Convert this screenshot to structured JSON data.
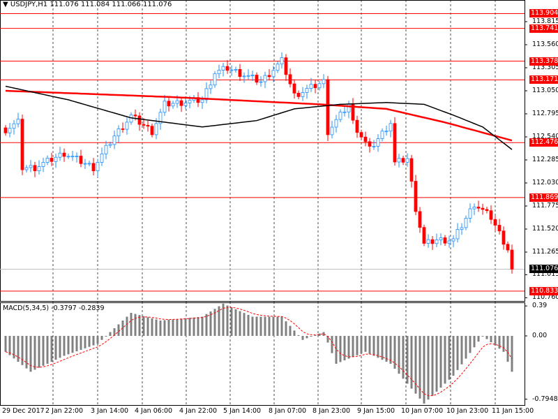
{
  "header": {
    "title": "USDJPY,H1",
    "ohlc": "111.076 111.084 111.066 111.076"
  },
  "macd": {
    "label": "MACD(5,34,5)",
    "values": "-0.3797 -0.2839",
    "axis": [
      "0.39",
      "0.00",
      "-0.7948"
    ]
  },
  "colors": {
    "up": "#1e90ff",
    "down": "#ff0000",
    "levels": "#ff0000",
    "ma_slow": "#ff0000",
    "ma_fast": "#000000",
    "hist": "#808080",
    "signal": "#ff0000"
  },
  "chart_data": {
    "type": "candlestick",
    "symbol": "USDJPY",
    "timeframe": "H1",
    "price_ticks": [
      "113.815",
      "113.560",
      "113.305",
      "113.050",
      "112.795",
      "112.540",
      "112.285",
      "112.030",
      "111.775",
      "111.520",
      "111.265",
      "111.015",
      "110.760"
    ],
    "levels": [
      "113.904",
      "113.741",
      "113.378",
      "113.171",
      "112.476",
      "111.869",
      "110.833"
    ],
    "current_price": "111.076",
    "time_labels": [
      "29 Dec 2017",
      "2 Jan 22:00",
      "3 Jan 14:00",
      "4 Jan 06:00",
      "4 Jan 22:00",
      "5 Jan 14:00",
      "8 Jan 07:00",
      "8 Jan 23:00",
      "9 Jan 15:00",
      "10 Jan 07:00",
      "10 Jan 23:00",
      "11 Jan 15:00"
    ],
    "candle_count": 122,
    "close_keypoints": [
      [
        0,
        112.62
      ],
      [
        3,
        112.7
      ],
      [
        4,
        112.2
      ],
      [
        7,
        112.2
      ],
      [
        14,
        112.36
      ],
      [
        21,
        112.2
      ],
      [
        26,
        112.55
      ],
      [
        30,
        112.77
      ],
      [
        35,
        112.6
      ],
      [
        38,
        112.9
      ],
      [
        47,
        112.95
      ],
      [
        50,
        113.25
      ],
      [
        53,
        113.3
      ],
      [
        61,
        113.15
      ],
      [
        66,
        113.38
      ],
      [
        69,
        113.0
      ],
      [
        76,
        113.15
      ],
      [
        77,
        112.6
      ],
      [
        82,
        112.9
      ],
      [
        83,
        112.7
      ],
      [
        87,
        112.4
      ],
      [
        92,
        112.7
      ],
      [
        93,
        112.25
      ],
      [
        96,
        112.3
      ],
      [
        98,
        111.75
      ],
      [
        100,
        111.35
      ],
      [
        103,
        111.4
      ],
      [
        107,
        111.4
      ],
      [
        112,
        111.8
      ],
      [
        116,
        111.65
      ],
      [
        120,
        111.3
      ],
      [
        121,
        111.076
      ]
    ],
    "ma_slow_keypoints": [
      [
        0,
        113.05
      ],
      [
        40,
        112.98
      ],
      [
        75,
        112.9
      ],
      [
        91,
        112.85
      ],
      [
        105,
        112.7
      ],
      [
        121,
        112.5
      ]
    ],
    "ma_fast_keypoints": [
      [
        0,
        113.1
      ],
      [
        15,
        112.95
      ],
      [
        30,
        112.75
      ],
      [
        47,
        112.65
      ],
      [
        60,
        112.72
      ],
      [
        69,
        112.85
      ],
      [
        80,
        112.9
      ],
      [
        91,
        112.92
      ],
      [
        100,
        112.9
      ],
      [
        107,
        112.78
      ],
      [
        114,
        112.65
      ],
      [
        121,
        112.4
      ]
    ],
    "macd_hist_keypoints": [
      [
        0,
        -0.2
      ],
      [
        6,
        -0.45
      ],
      [
        14,
        -0.25
      ],
      [
        22,
        -0.1
      ],
      [
        30,
        0.3
      ],
      [
        37,
        0.2
      ],
      [
        47,
        0.25
      ],
      [
        52,
        0.42
      ],
      [
        59,
        0.25
      ],
      [
        66,
        0.25
      ],
      [
        71,
        -0.05
      ],
      [
        76,
        0.05
      ],
      [
        79,
        -0.35
      ],
      [
        86,
        -0.2
      ],
      [
        92,
        -0.35
      ],
      [
        100,
        -0.85
      ],
      [
        107,
        -0.5
      ],
      [
        114,
        0.0
      ],
      [
        119,
        -0.2
      ],
      [
        121,
        -0.45
      ]
    ]
  }
}
